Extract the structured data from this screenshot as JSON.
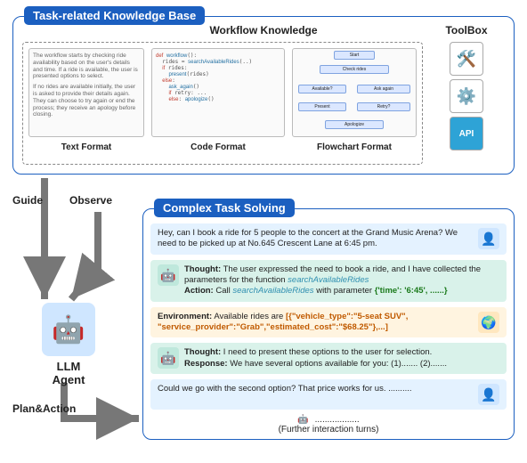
{
  "kb": {
    "title": "Task-related Knowledge Base",
    "workflow_title": "Workflow Knowledge",
    "text_panel": {
      "p1": "The workflow starts by checking ride availability based on the user's details and time. If a ride is available, the user is presented options to select.",
      "p2": "If no rides are available initially, the user is asked to provide their details again. They can choose to try again or end the process; they receive an apology before closing.",
      "label": "Text Format"
    },
    "code_panel": {
      "label": "Code Format"
    },
    "flow_panel": {
      "label": "Flowchart Format"
    },
    "toolbox": {
      "title": "ToolBox",
      "icons": [
        "tools-icon",
        "gear-icon",
        "api-icon"
      ]
    }
  },
  "cts": {
    "title": "Complex Task Solving",
    "user_msg1": "Hey, can I book a ride for 5 people to the concert at the Grand Music Arena? We need to be picked up at No.645 Crescent Lane at 6:45 pm.",
    "bot_msg1": {
      "thought_label": "Thought:",
      "thought": "The user expressed the need to book a ride, and I have collected the parameters for the function ",
      "fn1": "searchAvailableRides",
      "action_label": "Action:",
      "action_pre": "Call ",
      "fn2": "searchAvailableRides",
      "action_post": " with parameter ",
      "param": "{'time': '6:45', ......}"
    },
    "env_msg": {
      "env_label": "Environment:",
      "pre": "Available rides are ",
      "json": "[{\"vehicle_type\":\"5-seat SUV\", \"service_provider\":\"Grab\",\"estimated_cost\":\"$68.25\"},...]"
    },
    "bot_msg2": {
      "thought_label": "Thought:",
      "thought": "I need to present these options to the user for selection.",
      "resp_label": "Response:",
      "resp": "We have several options available for you: (1)....... (2).......",
      "": ""
    },
    "user_msg2": "Could we go with the second option? That price works for us. ..........",
    "further": "..................\n(Further interaction turns)"
  },
  "labels": {
    "guide": "Guide",
    "observe": "Observe",
    "plan": "Plan&Action",
    "agent": "LLM\nAgent"
  }
}
